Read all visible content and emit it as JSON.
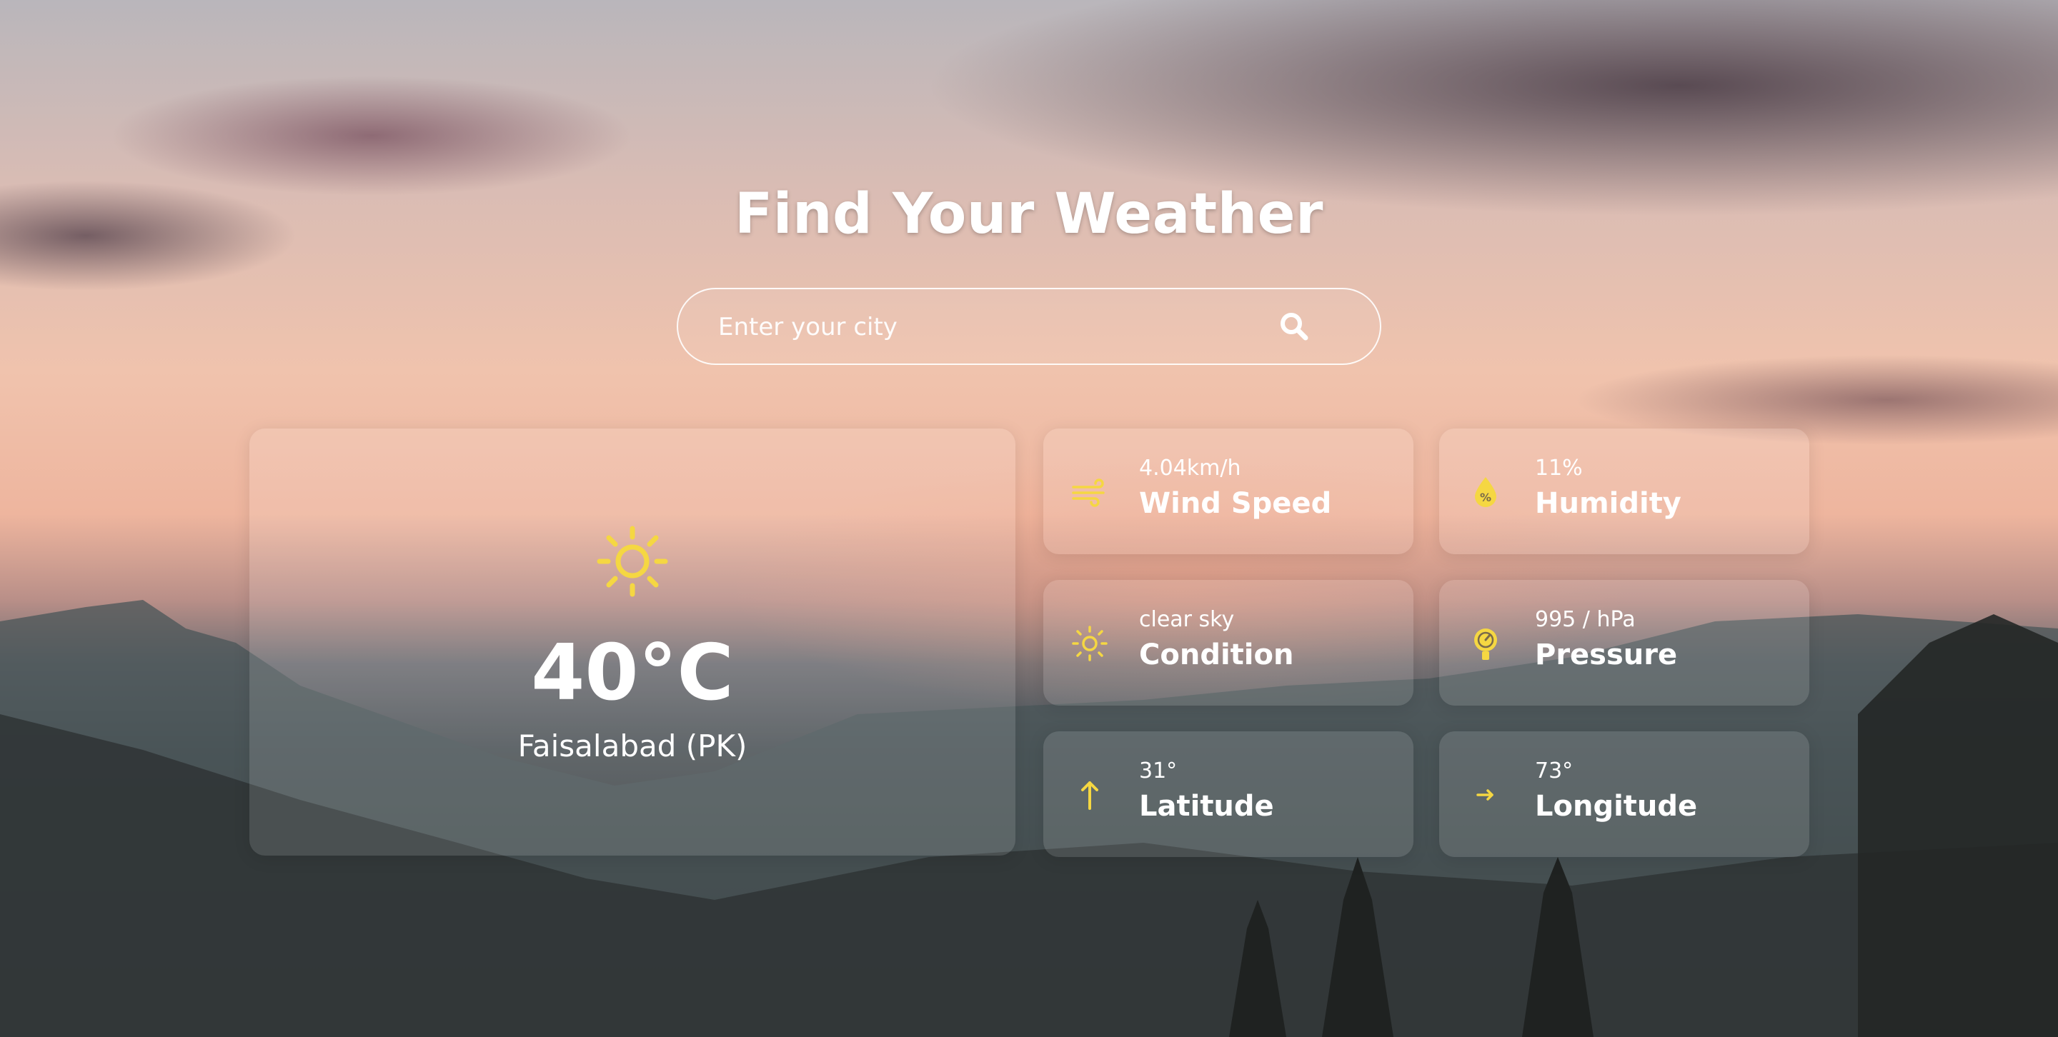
{
  "header": {
    "title": "Find Your Weather"
  },
  "search": {
    "placeholder": "Enter your city",
    "value": ""
  },
  "current": {
    "temperature": "40°C",
    "location": "Faisalabad (PK)",
    "icon": "sun-icon"
  },
  "details": [
    {
      "value": "4.04km/h",
      "label": "Wind Speed",
      "icon": "wind-icon"
    },
    {
      "value": "11%",
      "label": "Humidity",
      "icon": "humidity-drop-icon"
    },
    {
      "value": "clear sky",
      "label": "Condition",
      "icon": "sun-icon"
    },
    {
      "value": "995 / hPa",
      "label": "Pressure",
      "icon": "pressure-gauge-icon"
    },
    {
      "value": "31°",
      "label": "Latitude",
      "icon": "arrow-up-icon"
    },
    {
      "value": "73°",
      "label": "Longitude",
      "icon": "arrow-right-icon"
    }
  ],
  "colors": {
    "accent": "#f5d742",
    "text": "#ffffff"
  }
}
